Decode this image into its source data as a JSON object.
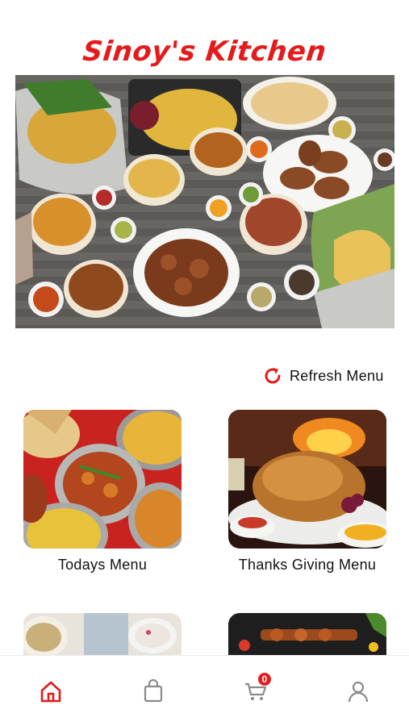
{
  "header": {
    "brand_title": "Sinoy's Kitchen"
  },
  "carousel": {
    "image": "indian-food-spread-photo",
    "total_slides": 6,
    "active_slide": 1,
    "active_color": "#e41b1b"
  },
  "refresh": {
    "label": "Refresh Menu",
    "icon": "refresh-icon"
  },
  "menu_cards": [
    {
      "label": "Todays Menu",
      "image": "curry-and-rice-photo"
    },
    {
      "label": "Thanks Giving Menu",
      "image": "roast-turkey-photo"
    },
    {
      "label": "",
      "image": "rice-and-raita-photo"
    },
    {
      "label": "",
      "image": "grilled-skewers-photo"
    }
  ],
  "bottom_nav": {
    "items": [
      {
        "name": "home",
        "icon": "home-icon",
        "active": true
      },
      {
        "name": "orders",
        "icon": "shopping-bag-icon",
        "active": false
      },
      {
        "name": "cart",
        "icon": "cart-icon",
        "active": false,
        "badge": "0"
      },
      {
        "name": "profile",
        "icon": "user-icon",
        "active": false
      }
    ],
    "active_color": "#e41b1b",
    "inactive_color": "#8a8a8a"
  },
  "colors": {
    "brand": "#e41b1b",
    "background": "#ffffff"
  }
}
